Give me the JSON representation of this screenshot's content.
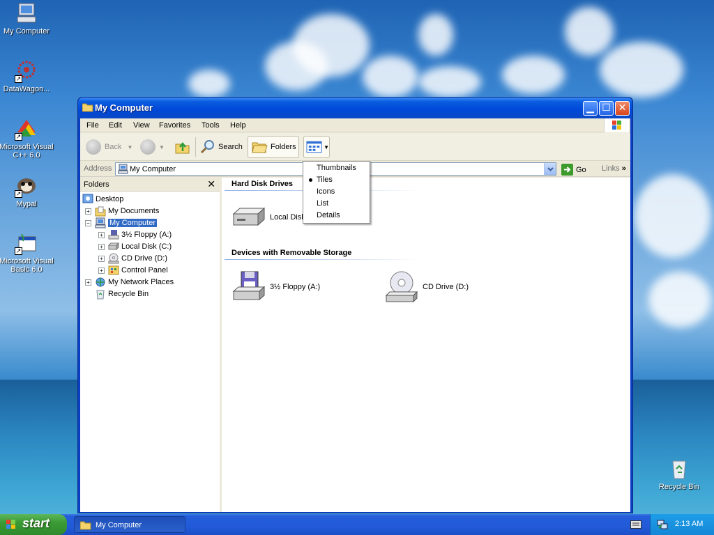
{
  "desktop": {
    "icons": [
      {
        "label": "My Computer"
      },
      {
        "label": "DataWagon..."
      },
      {
        "label": "Microsoft Visual C++ 6.0"
      },
      {
        "label": "Mypal"
      },
      {
        "label": "Microsoft Visual Basic 6.0"
      },
      {
        "label": "Recycle Bin"
      }
    ]
  },
  "window": {
    "title": "My Computer",
    "menu": [
      "File",
      "Edit",
      "View",
      "Favorites",
      "Tools",
      "Help"
    ],
    "toolbar": {
      "back_label": "Back",
      "search_label": "Search",
      "folders_label": "Folders"
    },
    "address": {
      "label": "Address",
      "value": "My Computer",
      "go_label": "Go",
      "links_label": "Links"
    },
    "folders_pane": {
      "title": "Folders",
      "close_glyph": "✕",
      "tree": [
        {
          "label": "Desktop"
        },
        {
          "label": "My Documents"
        },
        {
          "label": "My Computer"
        },
        {
          "label": "3½ Floppy (A:)"
        },
        {
          "label": "Local Disk (C:)"
        },
        {
          "label": "CD Drive (D:)"
        },
        {
          "label": "Control Panel"
        },
        {
          "label": "My Network Places"
        },
        {
          "label": "Recycle Bin"
        }
      ]
    },
    "content": {
      "groups": [
        {
          "title": "Hard Disk Drives",
          "items": [
            {
              "label": "Local Disk"
            }
          ]
        },
        {
          "title": "Devices with Removable Storage",
          "items": [
            {
              "label": "3½ Floppy (A:)"
            },
            {
              "label": "CD Drive (D:)"
            }
          ]
        }
      ]
    },
    "views_menu": {
      "items": [
        "Thumbnails",
        "Tiles",
        "Icons",
        "List",
        "Details"
      ],
      "selected": "Tiles"
    }
  },
  "taskbar": {
    "start_label": "start",
    "task_label": "My Computer",
    "clock": "2:13 AM"
  },
  "colors": {
    "title_blue": "#0a48c4",
    "selection": "#316ac5",
    "start_green": "#3b9b35"
  }
}
